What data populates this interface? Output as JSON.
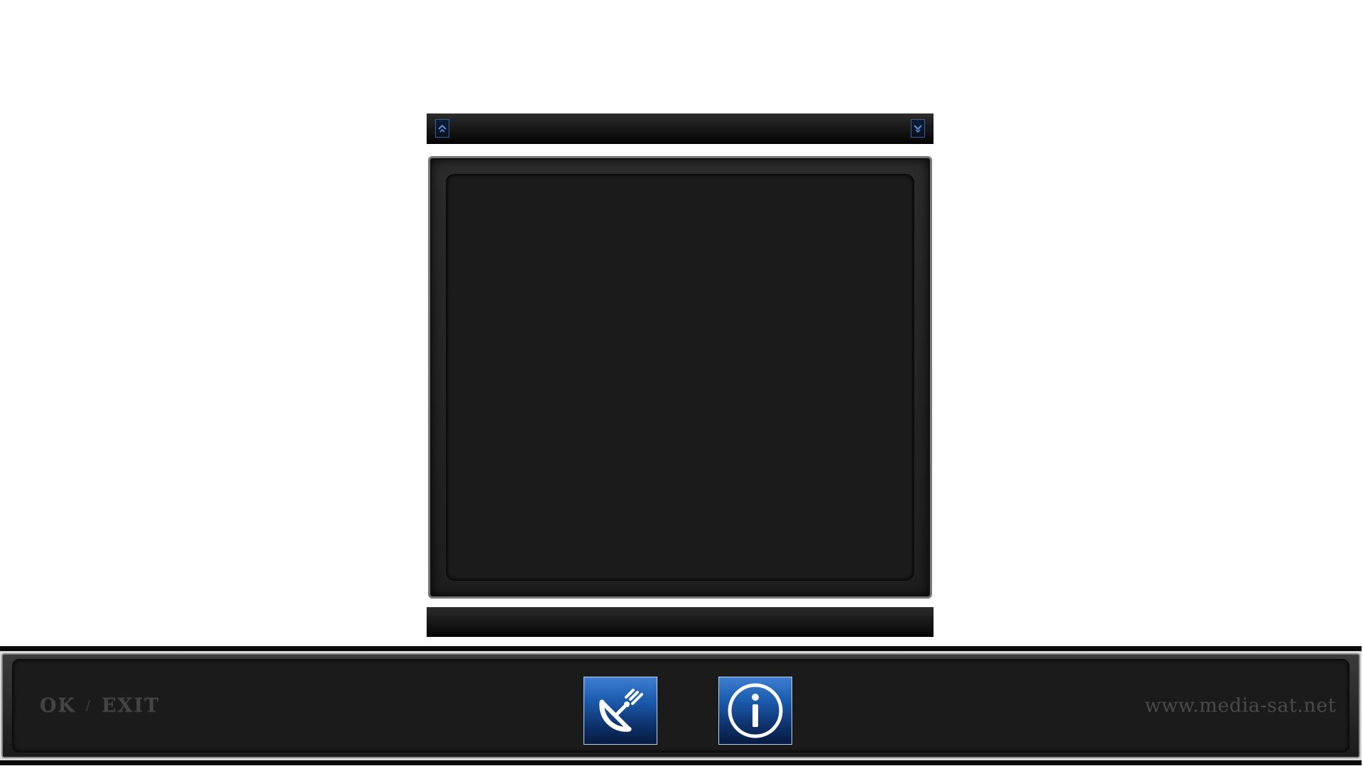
{
  "scroll": {
    "up_icon": "chevron-up-icon",
    "down_icon": "chevron-down-icon"
  },
  "footer": {
    "key_ok": "OK",
    "key_separator": "/",
    "key_exit": "EXIT",
    "website": "www.media-sat.net",
    "buttons": [
      {
        "icon": "satellite-dish-icon"
      },
      {
        "icon": "info-icon"
      }
    ]
  },
  "colors": {
    "accent_blue": "#1b5bae",
    "panel_dark": "#1b1b1b",
    "hint_text": "#444444"
  }
}
